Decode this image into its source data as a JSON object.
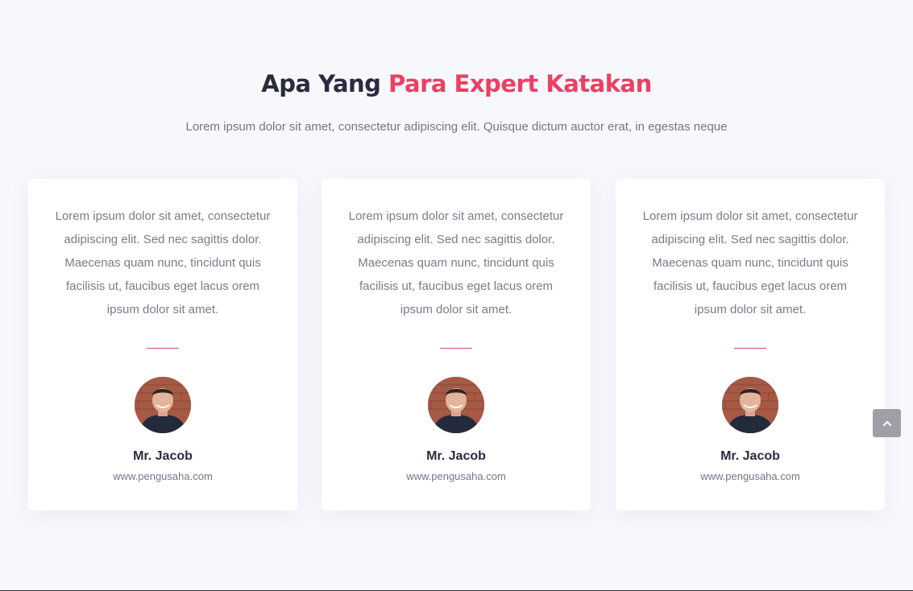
{
  "section": {
    "title_part1": "Apa Yang ",
    "title_part2": "Para Expert Katakan",
    "subtitle": "Lorem ipsum dolor sit amet, consectetur adipiscing elit. Quisque dictum auctor erat, in egestas neque"
  },
  "testimonials": [
    {
      "quote": "Lorem ipsum dolor sit amet, consectetur adipiscing elit. Sed nec sagittis dolor. Maecenas quam nunc, tincidunt quis facilisis ut, faucibus eget lacus orem ipsum dolor sit amet.",
      "name": "Mr. Jacob",
      "website": "www.pengusaha.com"
    },
    {
      "quote": "Lorem ipsum dolor sit amet, consectetur adipiscing elit. Sed nec sagittis dolor. Maecenas quam nunc, tincidunt quis facilisis ut, faucibus eget lacus orem ipsum dolor sit amet.",
      "name": "Mr. Jacob",
      "website": "www.pengusaha.com"
    },
    {
      "quote": "Lorem ipsum dolor sit amet, consectetur adipiscing elit. Sed nec sagittis dolor. Maecenas quam nunc, tincidunt quis facilisis ut, faucibus eget lacus orem ipsum dolor sit amet.",
      "name": "Mr. Jacob",
      "website": "www.pengusaha.com"
    }
  ],
  "scroll_top": {
    "icon": "chevron-up-icon"
  },
  "colors": {
    "accent": "#ec3f64",
    "heading": "#2b2b3f",
    "text": "#75758a",
    "background": "#f7f8fc",
    "card": "#ffffff",
    "scroll_button": "#a19ea7"
  }
}
